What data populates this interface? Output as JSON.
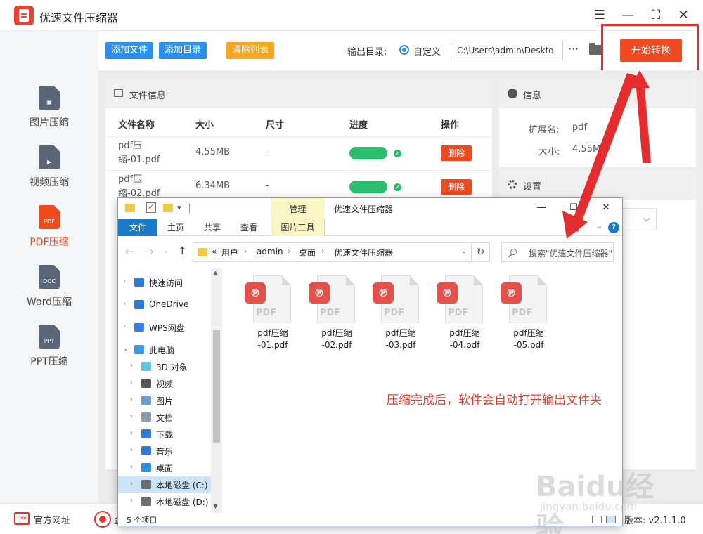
{
  "app": {
    "title": "优速文件压缩器"
  },
  "sidebar": {
    "items": [
      {
        "label": "图片压缩",
        "icon": "image-file-icon",
        "badge": ""
      },
      {
        "label": "视频压缩",
        "icon": "video-file-icon",
        "badge": ""
      },
      {
        "label": "PDF压缩",
        "icon": "pdf-file-icon",
        "badge": "PDF",
        "active": true
      },
      {
        "label": "Word压缩",
        "icon": "doc-file-icon",
        "badge": "DOC"
      },
      {
        "label": "PPT压缩",
        "icon": "ppt-file-icon",
        "badge": "PPT"
      }
    ]
  },
  "toolbar": {
    "add_file": "添加文件",
    "add_folder": "添加目录",
    "clear_list": "清除列表",
    "output_label": "输出目录:",
    "custom_label": "自定义",
    "output_path": "C:\\Users\\admin\\Deskto",
    "more": "···",
    "start": "开始转换"
  },
  "file_panel": {
    "title": "文件信息",
    "columns": [
      "文件名称",
      "大小",
      "尺寸",
      "进度",
      "操作"
    ],
    "rows": [
      {
        "name": "pdf压缩-01.pdf",
        "size": "4.55MB",
        "dimension": "-",
        "progress": 1.0,
        "action": "删除"
      },
      {
        "name": "pdf压缩-02.pdf",
        "size": "6.34MB",
        "dimension": "-",
        "progress": 1.0,
        "action": "删除"
      }
    ]
  },
  "info_panel": {
    "title": "信息",
    "ext_label": "扩展名:",
    "ext_value": "pdf",
    "size_label": "大小:",
    "size_value": "4.55MB"
  },
  "settings_panel": {
    "title": "设置"
  },
  "footer": {
    "site": "官方网址",
    "qq_partial": "企",
    "version_label": "版本:",
    "version_value": "v2.1.1.0"
  },
  "explorer": {
    "context_tab": "管理",
    "title": "优速文件压缩器",
    "ribbon_tabs": [
      "文件",
      "主页",
      "共享",
      "查看",
      "图片工具"
    ],
    "breadcrumb": [
      "用户",
      "admin",
      "桌面",
      "优速文件压缩器"
    ],
    "breadcrumb_prefix": "«",
    "search_placeholder": "搜索\"优速文件压缩器\"",
    "nav": [
      {
        "label": "快速访问",
        "icon": "star-icon",
        "color": "#2b7bd6",
        "level": 0,
        "expander": "›"
      },
      {
        "label": "OneDrive",
        "icon": "cloud-icon",
        "color": "#2b7bd6",
        "level": 0,
        "expander": "›"
      },
      {
        "label": "WPS网盘",
        "icon": "wps-cloud-icon",
        "color": "#3a7de0",
        "level": 0,
        "expander": "›"
      },
      {
        "label": "此电脑",
        "icon": "computer-icon",
        "color": "#3b9ad9",
        "level": 0,
        "expander": "⌄"
      },
      {
        "label": "3D 对象",
        "icon": "cube-icon",
        "color": "#5ec4e8",
        "level": 1,
        "expander": "›"
      },
      {
        "label": "视频",
        "icon": "film-icon",
        "color": "#555555",
        "level": 1,
        "expander": "›"
      },
      {
        "label": "图片",
        "icon": "picture-icon",
        "color": "#6aa0d0",
        "level": 1,
        "expander": "›"
      },
      {
        "label": "文档",
        "icon": "document-icon",
        "color": "#8a9bb0",
        "level": 1,
        "expander": "›"
      },
      {
        "label": "下载",
        "icon": "download-arrow-icon",
        "color": "#2b7bd6",
        "level": 1,
        "expander": "›"
      },
      {
        "label": "音乐",
        "icon": "music-note-icon",
        "color": "#2b7bd6",
        "level": 1,
        "expander": "›"
      },
      {
        "label": "桌面",
        "icon": "desktop-icon",
        "color": "#2b8fe0",
        "level": 1,
        "expander": "›"
      },
      {
        "label": "本地磁盘 (C:)",
        "icon": "drive-icon",
        "color": "#6d6d6d",
        "level": 1,
        "expander": "›",
        "selected": true
      },
      {
        "label": "本地磁盘 (D:)",
        "icon": "drive-icon",
        "color": "#6d6d6d",
        "level": 1,
        "expander": "›"
      }
    ],
    "files": [
      {
        "line1": "pdf压缩",
        "line2": "-01.pdf"
      },
      {
        "line1": "pdf压缩",
        "line2": "-02.pdf"
      },
      {
        "line1": "pdf压缩",
        "line2": "-03.pdf"
      },
      {
        "line1": "pdf压缩",
        "line2": "-04.pdf"
      },
      {
        "line1": "pdf压缩",
        "line2": "-05.pdf"
      }
    ],
    "pdf_word": "PDF",
    "annotation": "压缩完成后，软件会自动打开输出文件夹",
    "status": "5 个项目"
  },
  "watermark": {
    "logo": "Baidu经验",
    "sub": "jingyan.baidu.com"
  },
  "colors": {
    "accent": "#f0491e",
    "blue": "#2b8ff0",
    "orange": "#f6a623",
    "success": "#2dbd6e",
    "annotation": "#e23a2c"
  }
}
